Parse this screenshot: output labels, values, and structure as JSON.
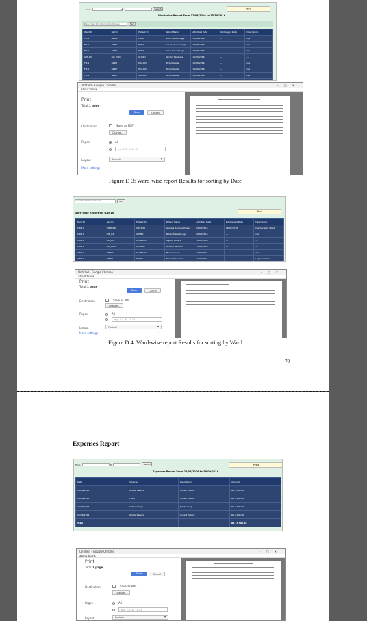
{
  "fig_d3": {
    "filter": {
      "from_label": "From",
      "to_label": "To",
      "search_label": "Search",
      "print_label": "Print"
    },
    "report_title": "Ward-wise Report From 12/06/2016 to 15/10/2016",
    "search_placeholder": "Select Ward ID To Filter D..Ward Between",
    "go_label": "Sort",
    "columns": [
      "Ward ID",
      "Bed ID",
      "Patient ID",
      "Patient Name",
      "Admitted Date",
      "Discharged Date",
      "Description"
    ],
    "rows": [
      [
        "FM-1",
        "G6DG",
        "P8D2",
        "Nirosi Karubhnage",
        "12/06/2016",
        "---",
        "n/a"
      ],
      [
        "FM-1",
        "G6D4",
        "P8D4",
        "Ganzan Kumarsingh",
        "12/06/2016",
        "---",
        "n/a"
      ],
      [
        "FM-1",
        "G6D2",
        "P8D2",
        "Nirosi Karubhnage",
        "12/06/2016",
        "---",
        "n/a"
      ],
      [
        "ICW-10",
        "ICB_C8D4",
        "IC-N2D",
        "Pandhu Sambara",
        "11/09/2016",
        "---",
        "---"
      ],
      [
        "FM-1",
        "G6D8",
        "MA1D03",
        "Mirzad Gaiua",
        "12/06/2016",
        "---",
        "n/a"
      ],
      [
        "FM-1",
        "G6D2",
        "MA1D03",
        "Mirzad Gaiua",
        "12/06/2016",
        "---",
        "n/a"
      ],
      [
        "FM-1",
        "G6D2",
        "MA1D03",
        "Mirzad Gaiua",
        "15/09/2016",
        "---",
        "n/a"
      ],
      [
        "Mens Gen",
        "G6D7",
        "IC-N2D4",
        "Mirzad Gaiu",
        "12/10/2016",
        "---",
        "n/a"
      ],
      [
        "FM-1",
        "G6D8",
        "MA1D03",
        "Mirzad Gaiua",
        "15/10/2016",
        "---",
        "n/a"
      ]
    ],
    "print_dialog": {
      "window_title": "Untitled - Google Chrome",
      "url": "about:blank",
      "heading": "Print",
      "total_label": "Total:",
      "total_value": "1 page",
      "save_label": "Save",
      "cancel_label": "Cancel",
      "destination_label": "Destination",
      "destination_value": "Save as PDF",
      "change_label": "Change...",
      "pages_label": "Pages",
      "pages_all": "All",
      "pages_placeholder": "e.g. 1-5, 8, 11-13",
      "layout_label": "Layout",
      "layout_value": "Portrait",
      "more_settings": "More settings"
    },
    "caption": "Figure D 3: Ward-wise report Results for sorting by Date"
  },
  "fig_d4": {
    "search_placeholder": "Select Ward ID To Sort Record",
    "go_label": "Sort",
    "print_label": "Print",
    "report_title": "Ward-wise Report for ICW-10",
    "columns": [
      "Ward ID",
      "Bed ID",
      "Patient ID",
      "Patient Name",
      "Admitted Date",
      "Discharged Date",
      "Description"
    ],
    "rows": [
      [
        "ICW-10",
        "ICB0D1D",
        "ICP1D03",
        "Gamani Ramanathnayi",
        "09/09/2016",
        "09/09/2016",
        "Discharge to Ward"
      ],
      [
        "ICW-10",
        "ICB_C4",
        "ICP-N27",
        "Rohan Mahathunga",
        "09/09/2016",
        "---",
        "n/a"
      ],
      [
        "ICW-10",
        "ICB_D3",
        "IC-KN02D",
        "Sajitha Ruhara",
        "18/02/2016",
        "---",
        "---"
      ],
      [
        "ICW-10",
        "ICB_C8D4",
        "IC-N02D",
        "Pandhu Sambara",
        "11/09/2016",
        "---",
        "---"
      ],
      [
        "ICW-10",
        "ICBD02",
        "IC-KN02D",
        "Mirzade Gaiu",
        "12/09/2016",
        "---",
        "n/a"
      ],
      [
        "ICW-10",
        "ICBD4",
        "P8D03",
        "Kumar Sheshara",
        "14/10/2016",
        "---",
        "Urgent Patient"
      ]
    ],
    "print_dialog": {
      "window_title": "Untitled - Google Chrome",
      "url": "about:blank",
      "heading": "Print",
      "total_label": "Total:",
      "total_value": "1 page",
      "save_label": "Save",
      "cancel_label": "Cancel",
      "destination_label": "Destination",
      "destination_value": "Save as PDF",
      "change_label": "Change...",
      "pages_label": "Pages",
      "pages_all": "All",
      "pages_placeholder": "e.g. 1-5, 8, 11-13",
      "layout_label": "Layout",
      "layout_value": "Portrait",
      "more_settings": "More settings"
    },
    "caption": "Figure D 4: Ward-wise report Results for sorting by Ward"
  },
  "page1_number": "70",
  "expenses": {
    "heading": "Expenses Report",
    "filter": {
      "from_label": "From",
      "to_label": "To",
      "search_label": "Search",
      "print_label": "Print"
    },
    "report_title": "Expenses Report From 26/06/2016 to 26/09/2016",
    "columns": [
      "Date",
      "Expense",
      "Description",
      "Amount"
    ],
    "rows": [
      [
        "26/06/2016",
        "Vehicle Service",
        "Urgent Patient",
        "RS 3,500.00"
      ],
      [
        "26/06/2016",
        "Travel",
        "Urgent Patient",
        "RS 4,000.00"
      ],
      [
        "26/06/2016",
        "Medical Drugs",
        "Job Seeking",
        "RS 3,000.00"
      ],
      [
        "26/06/2016",
        "Vehicle Service",
        "Urgent Patient",
        "RS 2,000.00"
      ]
    ],
    "total_label": "Total",
    "total_value": "RS 15,500.00",
    "print_dialog": {
      "window_title": "Untitled - Google Chrome",
      "url": "about:blank",
      "heading": "Print",
      "total_label": "Total:",
      "total_value": "1 page",
      "save_label": "Save",
      "cancel_label": "Cancel",
      "destination_label": "Destination",
      "destination_value": "Save as PDF",
      "change_label": "Change...",
      "pages_label": "Pages",
      "pages_all": "All",
      "pages_placeholder": "e.g. 1-5, 8, 11-13",
      "layout_label": "Layout",
      "layout_value": "Portrait"
    }
  }
}
